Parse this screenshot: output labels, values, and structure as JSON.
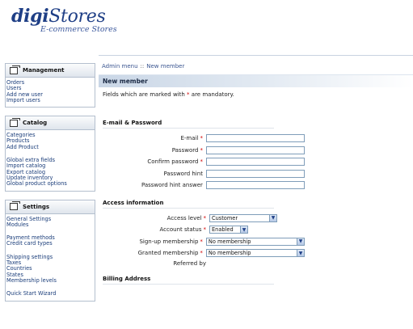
{
  "logo": {
    "main_bold": "digi",
    "main_rest": "Stores",
    "sub": "E-commerce Stores"
  },
  "breadcrumb": {
    "root": "Admin menu",
    "separator": "::",
    "current": "New member"
  },
  "sidebar": {
    "management": {
      "title": "Management",
      "items": [
        "Orders",
        "Users",
        "Add new user",
        "Import users"
      ]
    },
    "catalog": {
      "title": "Catalog",
      "items_a": [
        "Categories",
        "Products",
        "Add Product"
      ],
      "items_b": [
        "Global extra fields",
        "Import catalog",
        "Export catalog",
        "Update inventory",
        "Global product options"
      ]
    },
    "settings": {
      "title": "Settings",
      "items_a": [
        "General Settings",
        "Modules"
      ],
      "items_b": [
        "Payment methods",
        "Credit card types"
      ],
      "items_c": [
        "Shipping settings",
        "Taxes",
        "Countries",
        "States",
        "Membership levels"
      ],
      "items_d": [
        "Quick Start Wizard"
      ]
    }
  },
  "main": {
    "section_title": "New member",
    "mandatory_note_pre": "Fields which are marked with",
    "mandatory_star": "*",
    "mandatory_note_post": "are mandatory.",
    "email_group": {
      "title": "E-mail & Password",
      "fields": [
        {
          "label": "E-mail",
          "required": "*",
          "value": ""
        },
        {
          "label": "Password",
          "required": "*",
          "value": ""
        },
        {
          "label": "Confirm password",
          "required": "*",
          "value": ""
        },
        {
          "label": "Password hint",
          "required": "",
          "value": ""
        },
        {
          "label": "Password hint answer",
          "required": "",
          "value": ""
        }
      ]
    },
    "access_group": {
      "title": "Access information",
      "access_level": {
        "label": "Access level",
        "required": "*",
        "value": "Customer"
      },
      "account_status": {
        "label": "Account status",
        "required": "*",
        "value": "Enabled"
      },
      "signup_membership": {
        "label": "Sign-up membership",
        "required": "*",
        "value": "No membership"
      },
      "granted_membership": {
        "label": "Granted membership",
        "required": "*",
        "value": "No membership"
      },
      "referred_by": {
        "label": "Referred by"
      }
    },
    "billing_group": {
      "title": "Billing Address"
    }
  },
  "icons": {
    "dropdown": "chevron-down-icon",
    "box": "window-icon"
  },
  "colors": {
    "logo": "#1f3f86",
    "link": "#1a3d7a",
    "required": "#d00000",
    "bar": "#c9d6e6"
  }
}
